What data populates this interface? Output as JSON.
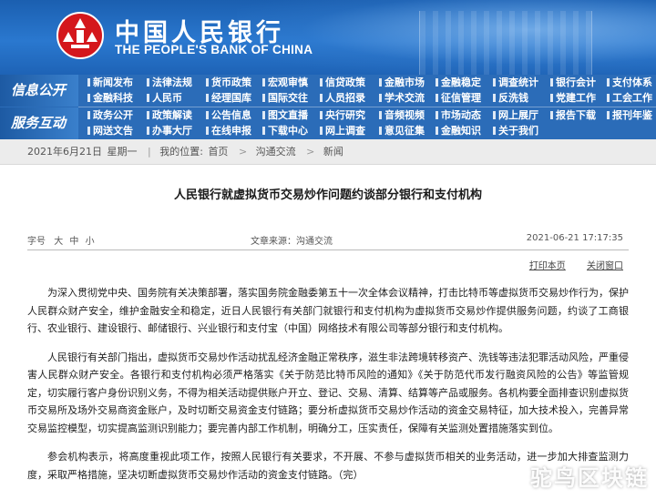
{
  "header": {
    "logo_cn": "中国人民银行",
    "logo_en": "THE PEOPLE'S BANK OF CHINA",
    "logo_color": "#d4171c"
  },
  "nav": {
    "sections": [
      "信息公开",
      "服务互动"
    ],
    "rows": [
      [
        "新闻发布",
        "法律法规",
        "货币政策",
        "宏观审慎",
        "信贷政策",
        "金融市场",
        "金融稳定",
        "调查统计",
        "银行会计",
        "支付体系"
      ],
      [
        "金融科技",
        "人民币",
        "经理国库",
        "国际交往",
        "人员招录",
        "学术交流",
        "征信管理",
        "反洗钱",
        "党建工作",
        "工会工作"
      ],
      [
        "政务公开",
        "政策解读",
        "公告信息",
        "图文直播",
        "央行研究",
        "音频视频",
        "市场动态",
        "网上展厅",
        "报告下载",
        "报刊年鉴"
      ],
      [
        "网送文告",
        "办事大厅",
        "在线申报",
        "下载中心",
        "网上调查",
        "意见征集",
        "金融知识",
        "关于我们"
      ]
    ]
  },
  "breadcrumb": {
    "date": "2021年6月21日",
    "weekday": "星期一",
    "location_label": "我的位置:",
    "items": [
      "首页",
      "沟通交流",
      "新闻"
    ],
    "separator": ">"
  },
  "article": {
    "title": "人民银行就虚拟货币交易炒作问题约谈部分银行和支付机构",
    "font_size_label": "字号",
    "font_sizes": [
      "大",
      "中",
      "小"
    ],
    "source_label": "文章来源：",
    "source": "沟通交流",
    "datetime": "2021-06-21  17:17:35",
    "print_label": "打印本页",
    "close_label": "关闭窗口",
    "paragraphs": [
      "为深入贯彻党中央、国务院有关决策部署，落实国务院金融委第五十一次全体会议精神，打击比特币等虚拟货币交易炒作行为，保护人民群众财产安全，维护金融安全和稳定，近日人民银行有关部门就银行和支付机构为虚拟货币交易炒作提供服务问题，约谈了工商银行、农业银行、建设银行、邮储银行、兴业银行和支付宝（中国）网络技术有限公司等部分银行和支付机构。",
      "人民银行有关部门指出，虚拟货币交易炒作活动扰乱经济金融正常秩序，滋生非法跨境转移资产、洗钱等违法犯罪活动风险，严重侵害人民群众财产安全。各银行和支付机构必须严格落实《关于防范比特币风险的通知》《关于防范代币发行融资风险的公告》等监管规定，切实履行客户身份识别义务，不得为相关活动提供账户开立、登记、交易、清算、结算等产品或服务。各机构要全面排查识别虚拟货币交易所及场外交易商资金账户，及时切断交易资金支付链路；要分析虚拟货币交易炒作活动的资金交易特征，加大技术投入，完善异常交易监控模型，切实提高监测识别能力；要完善内部工作机制，明确分工，压实责任，保障有关监测处置措施落实到位。",
      "参会机构表示，将高度重视此项工作，按照人民银行有关要求，不开展、不参与虚拟货币相关的业务活动，进一步加大排查监测力度，采取严格措施，坚决切断虚拟货币交易炒作活动的资金支付链路。（完）"
    ]
  },
  "watermark": "驼鸟区块链"
}
